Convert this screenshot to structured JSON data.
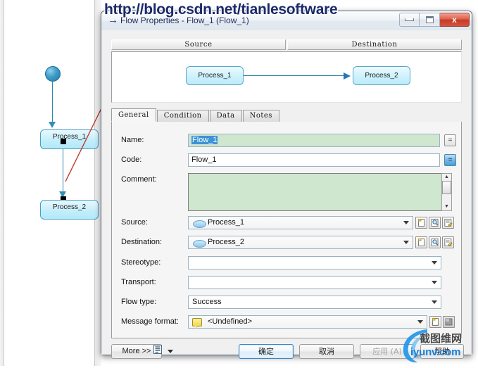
{
  "watermark": {
    "url_text": "http://blog.csdn.net/tianlesoftware",
    "logo_text": "iyunv.com",
    "logo_cjk": "截图维网"
  },
  "background_diagram": {
    "start_node_name": "start-node",
    "process_1": "Process_1",
    "process_2": "Process_2"
  },
  "dialog": {
    "titlebar": {
      "arrow_icon": "right-arrow-icon",
      "title": "Flow Properties - Flow_1 (Flow_1)",
      "minimize_label": "minimize",
      "maximize_label": "maximize",
      "close_label": "x"
    },
    "preview": {
      "headers": [
        "Source",
        "Destination"
      ],
      "nodes": [
        "Process_1",
        "Process_2"
      ]
    },
    "tabs": [
      {
        "label": "General",
        "active": true
      },
      {
        "label": "Condition",
        "active": false
      },
      {
        "label": "Data",
        "active": false
      },
      {
        "label": "Notes",
        "active": false
      }
    ],
    "fields": {
      "name": {
        "label_pre": "N",
        "label_accel": "a",
        "label_post": "me:",
        "label_full": "Name:",
        "value": "Flow_1",
        "selected": true,
        "eq_button": "="
      },
      "code": {
        "label_full": "Code:",
        "value": "Flow_1",
        "eq_button": "="
      },
      "comment": {
        "label_full": "Comment:",
        "value": ""
      },
      "source": {
        "label_full": "Source:",
        "value": "Process_1",
        "icon": "process-oval-icon",
        "buttons": [
          "create-object-button",
          "find-object-button",
          "object-properties-button"
        ]
      },
      "destination": {
        "label_full": "Destination:",
        "value": "Process_2",
        "icon": "process-oval-icon",
        "buttons": [
          "create-object-button",
          "find-object-button",
          "object-properties-button"
        ]
      },
      "stereotype": {
        "label_full": "Stereotype:",
        "value": ""
      },
      "transport": {
        "label_full": "Transport:",
        "value": ""
      },
      "flow_type": {
        "label_full": "Flow type:",
        "value": "Success"
      },
      "message_format": {
        "label_full": "Message format:",
        "value": "<Undefined>",
        "icon": "message-format-icon",
        "buttons": [
          "create-format-button",
          "format-properties-button"
        ]
      }
    },
    "buttons": {
      "more": "More >>",
      "report_icon": "report-list-icon",
      "report_dropdown": "report-dropdown-arrow",
      "ok": "确定",
      "cancel": "取消",
      "apply": "应用 (A)",
      "help": "帮助"
    }
  }
}
